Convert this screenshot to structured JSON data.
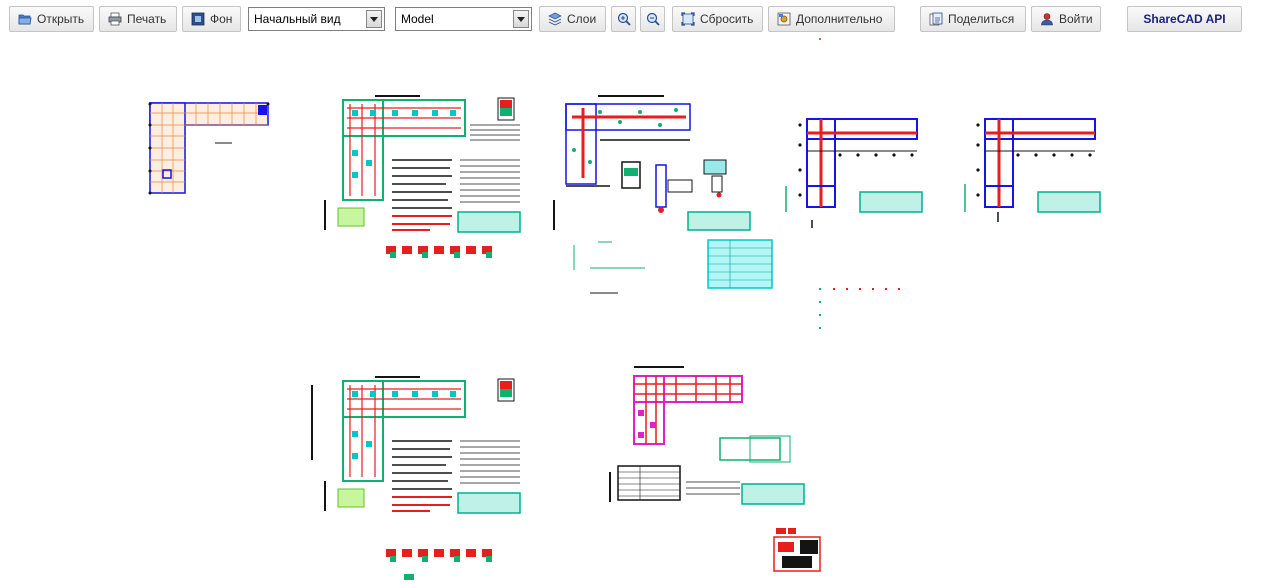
{
  "toolbar": {
    "open_label": "Открыть",
    "print_label": "Печать",
    "background_label": "Фон",
    "view_select_value": "Начальный вид",
    "layout_select_value": "Model",
    "layers_label": "Слои",
    "reset_label": "Сбросить",
    "more_label": "Дополнительно",
    "share_label": "Поделиться",
    "login_label": "Войти",
    "api_label": "ShareCAD API",
    "icons": [
      "folder-open-icon",
      "printer-icon",
      "background-icon",
      "layers-icon",
      "zoom-in-icon",
      "zoom-out-icon",
      "reset-view-icon",
      "more-settings-icon",
      "share-icon",
      "login-icon"
    ]
  },
  "drawing": {
    "colors": {
      "blue": "#1414e6",
      "red": "#e61e1e",
      "cyan": "#00c8c8",
      "green": "#10b070",
      "magenta": "#e020c8",
      "black": "#141414",
      "gray": "#8a8a8a"
    }
  }
}
